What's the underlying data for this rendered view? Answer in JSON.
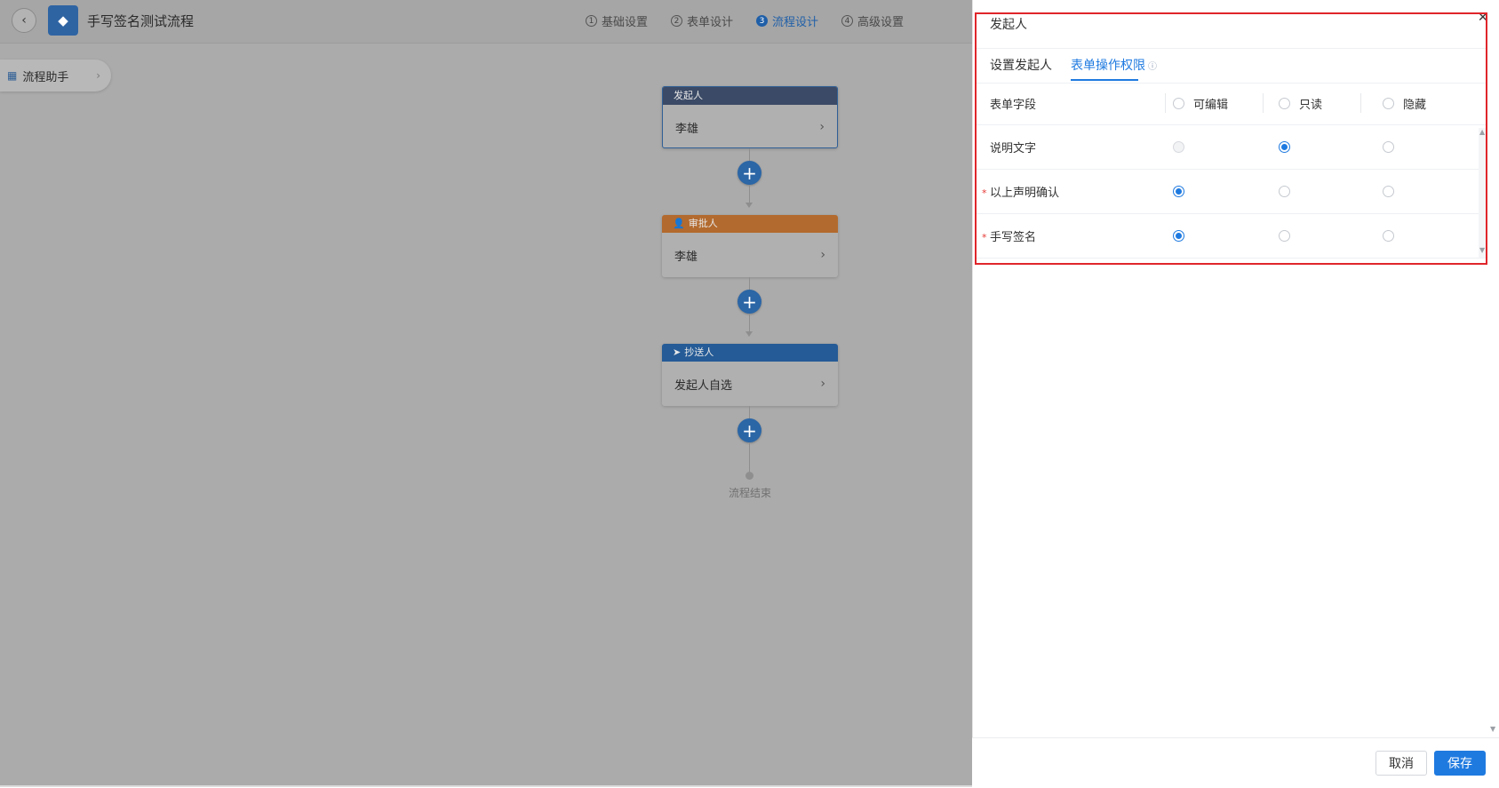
{
  "header": {
    "title": "手写签名测试流程",
    "steps": [
      {
        "num": "1",
        "label": "基础设置"
      },
      {
        "num": "2",
        "label": "表单设计"
      },
      {
        "num": "3",
        "label": "流程设计"
      },
      {
        "num": "4",
        "label": "高级设置"
      }
    ],
    "active_step": 3
  },
  "assistant": {
    "label": "流程助手"
  },
  "flow": {
    "nodes": [
      {
        "type": "发起人",
        "value": "李雄"
      },
      {
        "type": "审批人",
        "value": "李雄"
      },
      {
        "type": "抄送人",
        "value": "发起人自选"
      }
    ],
    "end_label": "流程结束"
  },
  "drawer": {
    "title": "发起人",
    "tabs": [
      {
        "label": "设置发起人"
      },
      {
        "label": "表单操作权限"
      }
    ],
    "active_tab": 1,
    "table": {
      "header": {
        "field": "表单字段",
        "editable": "可编辑",
        "readonly": "只读",
        "hidden": "隐藏"
      },
      "rows": [
        {
          "field": "说明文字",
          "required": false,
          "selected": "readonly",
          "editable_disabled": true
        },
        {
          "field": "以上声明确认",
          "required": true,
          "selected": "editable",
          "editable_disabled": false
        },
        {
          "field": "手写签名",
          "required": true,
          "selected": "editable",
          "editable_disabled": false
        }
      ]
    },
    "footer": {
      "cancel": "取消",
      "save": "保存"
    }
  },
  "colors": {
    "accent": "#1f7ae0",
    "highlight": "#e0262b",
    "start_node": "#3b4a66",
    "approver_node": "#b36a2e",
    "cc_node": "#255b96"
  }
}
